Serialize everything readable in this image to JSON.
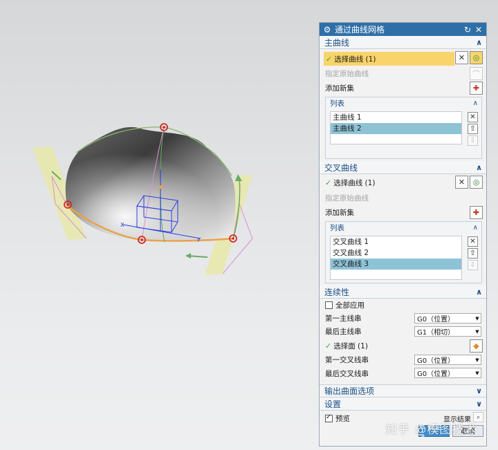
{
  "dialog": {
    "title": "通过曲线网格",
    "title_icon": "gear-icon",
    "reset_icon": "reset-icon",
    "close_icon": "close-icon"
  },
  "primary_curves": {
    "header": "主曲线",
    "select_label": "选择曲线 (1)",
    "origin_label": "指定原始曲线",
    "add_new_label": "添加新集",
    "list_header": "列表",
    "items": [
      "主曲线 1",
      "主曲线 2"
    ],
    "selected_index": 1
  },
  "cross_curves": {
    "header": "交叉曲线",
    "select_label": "选择曲线 (1)",
    "origin_label": "指定原始曲线",
    "add_new_label": "添加新集",
    "list_header": "列表",
    "items": [
      "交叉曲线 1",
      "交叉曲线 2",
      "交叉曲线 3"
    ],
    "selected_index": 2
  },
  "continuity": {
    "header": "连续性",
    "apply_all_label": "全部应用",
    "apply_all_checked": false,
    "first_primary_label": "第一主线串",
    "first_primary_value": "G0（位置）",
    "last_primary_label": "最后主线串",
    "last_primary_value": "G1（相切）",
    "select_face_label": "选择面 (1)",
    "first_cross_label": "第一交叉线串",
    "first_cross_value": "G0（位置）",
    "last_cross_label": "最后交叉线串",
    "last_cross_value": "G0（位置）"
  },
  "output_options": {
    "header": "输出曲面选项"
  },
  "settings": {
    "header": "设置"
  },
  "footer": {
    "preview_label": "预览",
    "preview_checked": true,
    "show_result_label": "显示结果",
    "ok_label": "< 确定 >",
    "cancel_label": "取消"
  },
  "watermark": "知乎 @模图技术",
  "colors": {
    "title_bar": "#2f6fa8",
    "section_text": "#1a4f86",
    "selection_yellow": "#f9d46a",
    "list_highlight": "#8ec3d6",
    "check_green": "#3aa637"
  }
}
